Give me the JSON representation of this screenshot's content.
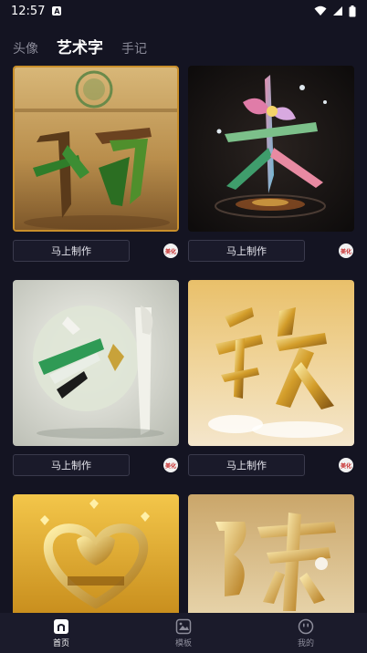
{
  "status": {
    "time": "12:57",
    "notification_glyph": "A"
  },
  "tabs": [
    {
      "label": "头像",
      "active": false
    },
    {
      "label": "艺术字",
      "active": true
    },
    {
      "label": "手记",
      "active": false
    }
  ],
  "cards": [
    {
      "button": "马上制作",
      "badge": "美化"
    },
    {
      "button": "马上制作",
      "badge": "美化"
    },
    {
      "button": "马上制作",
      "badge": "美化"
    },
    {
      "button": "马上制作",
      "badge": "美化"
    }
  ],
  "nav": [
    {
      "label": "首页",
      "icon": "home-icon",
      "active": true
    },
    {
      "label": "模板",
      "icon": "image-icon",
      "active": false
    },
    {
      "label": "我的",
      "icon": "smiley-icon",
      "active": false
    }
  ],
  "colors": {
    "background": "#141422",
    "navbar": "#1b1b2b",
    "accent_border": "#c98f2b"
  }
}
